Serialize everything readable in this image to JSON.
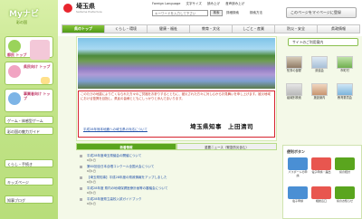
{
  "sidebar": {
    "title": "Myナビ",
    "subtitle": "彩の国",
    "cards": [
      {
        "label": "都民\nトップ"
      },
      {
        "label": "県民向け\nトップ"
      },
      {
        "label": "事業者向け\nトップ"
      }
    ],
    "links": [
      "ゲーム・体感型ゲーム",
      "彩の国の魅力ガイド"
    ],
    "bottom_links": [
      "くらし・手続き",
      "キッズページ",
      "知事ブログ"
    ]
  },
  "header": {
    "brand_name": "埼玉県",
    "brand_en": "Saitama Prefecture",
    "utility": [
      "Foreign Language",
      "文字サイズ",
      "読み上げ",
      "音声読み上げ"
    ],
    "search_placeholder": "キーワードを入力して下さい",
    "search_button": "検索",
    "mini_links": [
      "詳細検索",
      "検索方法"
    ],
    "page_settings": "このページをマイページに登録"
  },
  "nav": [
    "県のトップ",
    "くらし・環境",
    "健康・福祉",
    "教育・文化",
    "しごと・産業",
    "防災・安全",
    "県政情報"
  ],
  "announcement": {
    "text": "このたびの地震により亡くなられた方々のご冥福をお祈りするとともに、被災された方々に対し心からお見舞いを申し上げます。被災地域における復興を目指し、県民の皆様とともにしっかりと歩んでまいります。",
    "signature": "埼玉県知事　上田清司",
    "link": "平成28年熊本地震への埼玉県の対応について"
  },
  "tabs": [
    "新着情報",
    "重要ニュース（緊急防災含む）"
  ],
  "news": [
    {
      "title": "平成28年度埼玉県議会の開催について",
      "date": "6月1日"
    },
    {
      "title": "第60回全日本合唱コンクール全国大会について",
      "date": "6月1日"
    },
    {
      "title": "【埼玉県知事】平成28年度の県政情報をアップしました",
      "date": "6月1日"
    },
    {
      "title": "平成28年度 県内の地域保健医療計画等の審議会について",
      "date": "6月1日"
    },
    {
      "title": "平成28年度県立高校入試ガイドブック",
      "date": "6月1日"
    }
  ],
  "right_panel": {
    "button": "サイトのご利用案内",
    "tiles": [
      "知事の部屋",
      "県議会",
      "市町村",
      "組織別検索",
      "施設案内",
      "教育委員会"
    ],
    "section_title": "便利ボタン",
    "shortcuts": [
      "パスポートの申請",
      "電子申請・届出",
      "県の統計",
      "電子申請",
      "相談窓口",
      "県のお知らせ"
    ]
  },
  "colors": {
    "nav_active": "#5aa51e",
    "announcement_border": "#d6232d",
    "link": "#1f4fa8"
  }
}
